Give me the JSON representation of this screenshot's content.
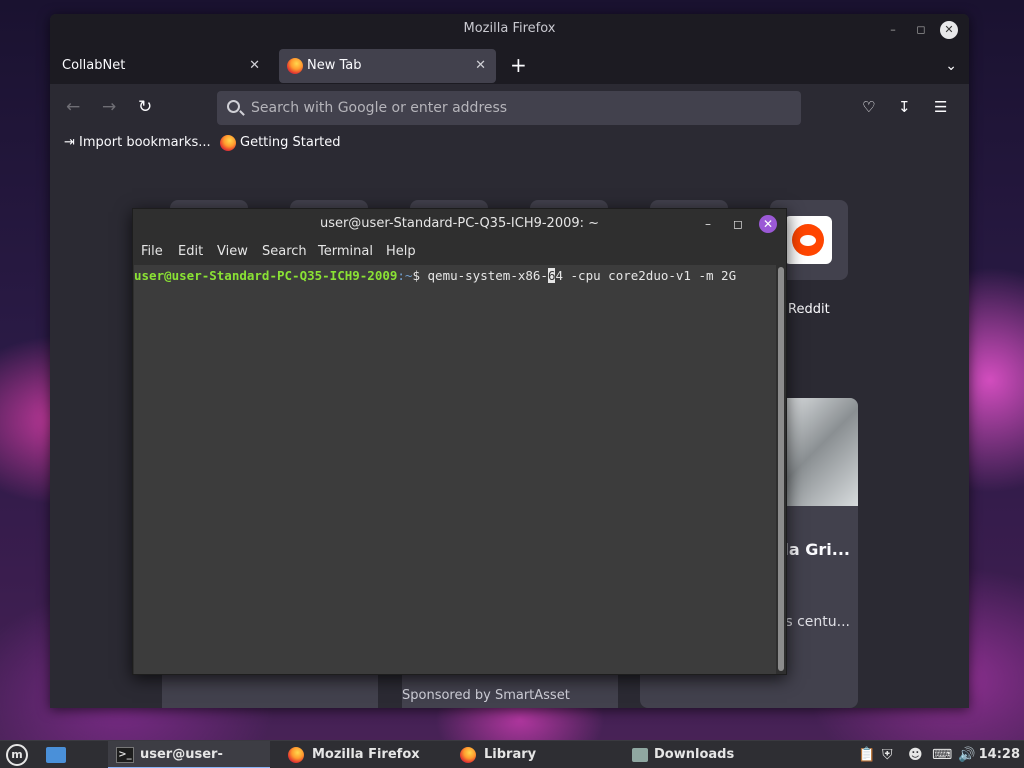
{
  "firefox": {
    "window_title": "Mozilla Firefox",
    "tabs": [
      {
        "label": "CollabNet"
      },
      {
        "label": "New Tab"
      }
    ],
    "urlbar_placeholder": "Search with Google or enter address",
    "bookmarks": [
      {
        "label": "Import bookmarks..."
      },
      {
        "label": "Getting Started"
      }
    ],
    "newtab": {
      "shortcut_label": "Reddit",
      "story_title": "hin: orida Gri...",
      "story_excerpt": "of the in shows centu...",
      "sponsored": "Sponsored by SmartAsset"
    }
  },
  "terminal": {
    "title": "user@user-Standard-PC-Q35-ICH9-2009: ~",
    "menu": [
      "File",
      "Edit",
      "View",
      "Search",
      "Terminal",
      "Help"
    ],
    "prompt_user": "user@user-Standard-PC-Q35-ICH9-2009",
    "prompt_path": ":~",
    "prompt_symbol": "$ ",
    "command_before_cursor": "qemu-system-x86-",
    "cursor_char": "6",
    "command_after_cursor": "4 -cpu core2duo-v1 -m 2G"
  },
  "taskbar": {
    "items": [
      {
        "label": "user@user-Stand..."
      },
      {
        "label": "Mozilla Firefox"
      },
      {
        "label": "Library"
      },
      {
        "label": "Downloads"
      }
    ],
    "clock": "14:28"
  }
}
